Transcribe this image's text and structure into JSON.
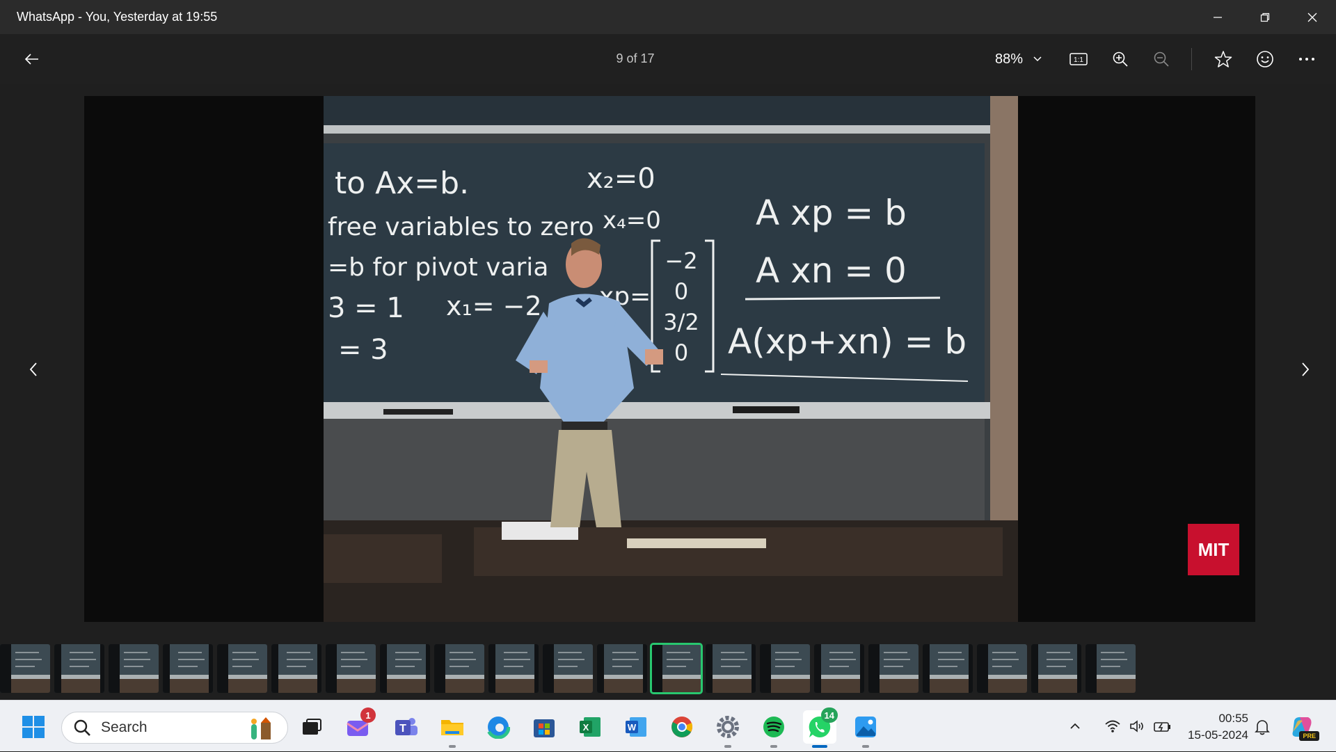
{
  "window": {
    "title": "WhatsApp - You, Yesterday at 19:55"
  },
  "toolbar": {
    "page_counter": "9 of 17",
    "zoom_level": "88%",
    "icons": [
      "back-arrow-icon",
      "chevron-down-icon",
      "actual-size-icon",
      "zoom-in-icon",
      "zoom-out-icon",
      "star-icon",
      "emoji-icon",
      "more-icon"
    ]
  },
  "photo": {
    "board_lines_left": [
      "to Ax=b.",
      "free variables to zero",
      "=b for pivot varia",
      "3 = 1",
      "= 3"
    ],
    "board_lines_mid": [
      "x₂=0",
      "x₄=0",
      "x₁= −2"
    ],
    "board_vector_label": "xp=",
    "board_vector": [
      "−2",
      "0",
      "3/2",
      "0"
    ],
    "board_equations": [
      "A xp = b",
      "A xn = 0",
      "A(xp+xn) = b"
    ],
    "logo_text": "MIT"
  },
  "filmstrip": {
    "count": 21,
    "active_index": 12
  },
  "taskbar": {
    "search_placeholder": "Search",
    "mail_badge": "1",
    "whatsapp_badge": "14",
    "time": "00:55",
    "date": "15-05-2024",
    "copilot_badge": "PRE",
    "apps": [
      "start-icon",
      "search-icon",
      "task-view-icon",
      "mail-icon",
      "teams-icon",
      "file-explorer-icon",
      "edge-icon",
      "store-icon",
      "excel-icon",
      "word-icon",
      "chrome-icon",
      "settings-icon",
      "spotify-icon",
      "whatsapp-icon",
      "photos-icon"
    ]
  },
  "colors": {
    "accent": "#28c76f",
    "chalkboard": "#2c3a44",
    "mit_red": "#c8102e"
  }
}
